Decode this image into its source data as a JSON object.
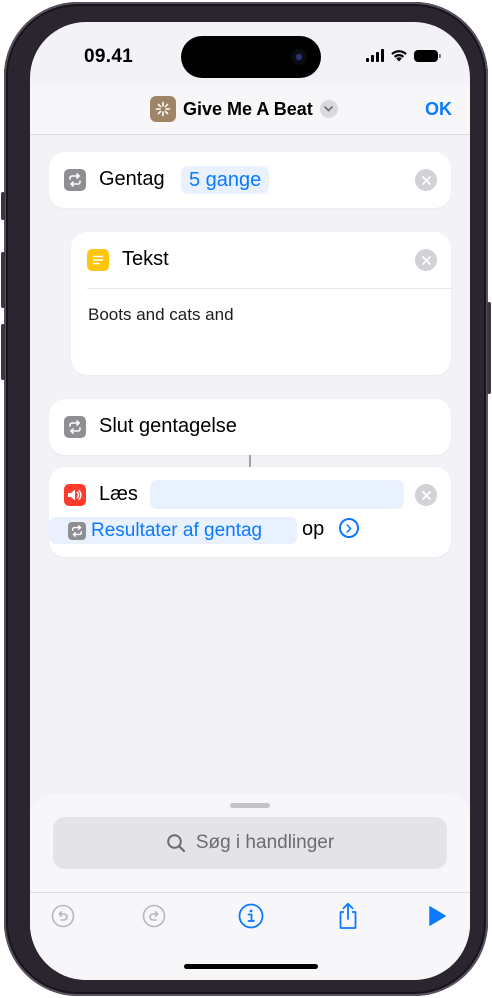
{
  "status_bar": {
    "time": "09.41"
  },
  "nav": {
    "title": "Give Me A Beat",
    "done": "OK"
  },
  "actions": {
    "repeat": {
      "label": "Gentag",
      "count": "5 gange"
    },
    "text": {
      "label": "Tekst",
      "content": "Boots and cats and"
    },
    "end_repeat": {
      "label": "Slut gentagelse"
    },
    "speak": {
      "label": "Læs",
      "variable": "Resultater af gentag",
      "suffix": "op"
    }
  },
  "search": {
    "placeholder": "Søg i handlinger"
  },
  "colors": {
    "accent": "#0A7AFF",
    "repeat_icon": "#8E8E93",
    "text_icon": "#FFC50A",
    "speak_icon": "#FF3B30"
  },
  "icons": [
    "repeat-icon",
    "text-icon",
    "speaker-icon",
    "undo-icon",
    "redo-icon",
    "info-icon",
    "share-icon",
    "play-icon",
    "search-icon"
  ]
}
